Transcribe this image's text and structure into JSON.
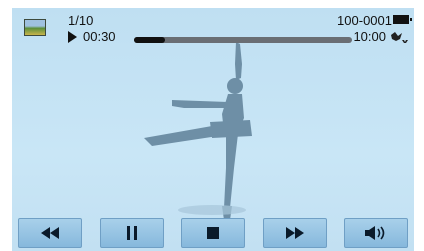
{
  "header": {
    "counter": "1/10",
    "elapsed_time": "00:30",
    "file_id": "100-0001",
    "duration": "10:00"
  },
  "playback": {
    "progress": 0.14
  },
  "icons": {
    "thumbnail": "photo-thumbnail-icon",
    "battery": "battery-full-icon",
    "quality": "quality-icon",
    "rewind": "rewind-icon",
    "pause": "pause-icon",
    "stop": "stop-icon",
    "fast_forward": "fast-forward-icon",
    "volume": "volume-icon"
  },
  "colors": {
    "screen_background": "#c4e2f4",
    "button_background": "#94c2e2",
    "silhouette": "#6e8fa6"
  }
}
